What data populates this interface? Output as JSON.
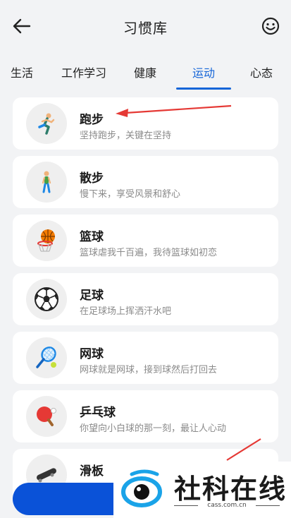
{
  "header": {
    "title": "习惯库",
    "back_icon": "arrow-left-icon",
    "smile_icon": "smile-face-icon"
  },
  "tabs": [
    {
      "label": "生活",
      "active": false
    },
    {
      "label": "工作学习",
      "active": false
    },
    {
      "label": "健康",
      "active": false
    },
    {
      "label": "运动",
      "active": true
    },
    {
      "label": "心态",
      "active": false
    }
  ],
  "habits": [
    {
      "name": "跑步",
      "desc": "坚持跑步，关键在坚持",
      "icon": "running-person-icon"
    },
    {
      "name": "散步",
      "desc": "慢下来，享受风景和舒心",
      "icon": "walking-person-icon"
    },
    {
      "name": "篮球",
      "desc": "篮球虐我千百遍，我待篮球如初恋",
      "icon": "basketball-icon"
    },
    {
      "name": "足球",
      "desc": "在足球场上挥洒汗水吧",
      "icon": "soccer-ball-icon"
    },
    {
      "name": "网球",
      "desc": "网球就是网球，接到球然后打回去",
      "icon": "tennis-racket-icon"
    },
    {
      "name": "乒乓球",
      "desc": "你望向小白球的那一刻，最让人心动",
      "icon": "ping-pong-icon"
    },
    {
      "name": "滑板",
      "desc": "",
      "icon": "skateboard-icon"
    }
  ],
  "watermark": {
    "text": "社科在线",
    "url": "cass.com.cn"
  },
  "colors": {
    "accent": "#1565d8",
    "annotation": "#e53935",
    "background": "#f2f3f5"
  }
}
